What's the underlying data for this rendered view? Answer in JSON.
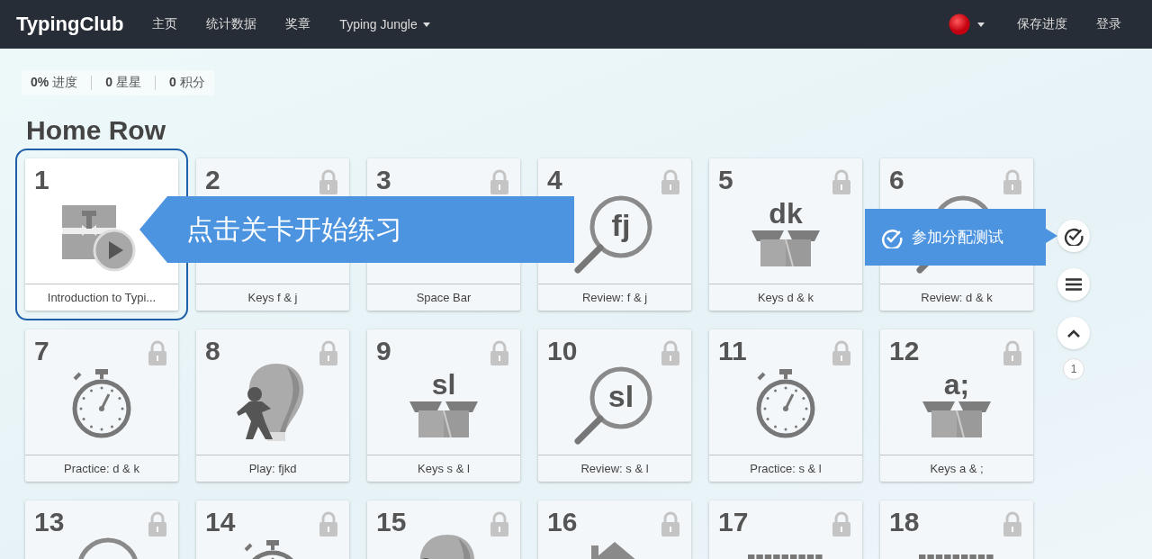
{
  "nav": {
    "logo": "TypingClub",
    "items": [
      {
        "label": "主页",
        "dropdown": false
      },
      {
        "label": "统计数据",
        "dropdown": false
      },
      {
        "label": "奖章",
        "dropdown": false
      },
      {
        "label": "Typing Jungle",
        "dropdown": true
      }
    ],
    "right_items": [
      "保存进度",
      "登录"
    ]
  },
  "stats": [
    {
      "value": "0%",
      "label": "进度"
    },
    {
      "value": "0",
      "label": "星星"
    },
    {
      "value": "0",
      "label": "积分"
    }
  ],
  "section_title": "Home Row",
  "lessons": [
    {
      "number": "1",
      "title": "Introduction to Typi...",
      "kind": "intro",
      "locked": false,
      "selected": true
    },
    {
      "number": "2",
      "title": "Keys f & j",
      "locked": true,
      "selected": false
    },
    {
      "number": "3",
      "title": "Space Bar",
      "locked": true,
      "selected": false
    },
    {
      "number": "4",
      "title": "Review: f & j",
      "kind": "review",
      "letters": "fj",
      "locked": true,
      "selected": false
    },
    {
      "number": "5",
      "title": "Keys d & k",
      "kind": "keys",
      "letters": "dk",
      "locked": true,
      "selected": false
    },
    {
      "number": "6",
      "title": "Review: d & k",
      "kind": "review",
      "locked": true,
      "selected": false
    },
    {
      "number": "7",
      "title": "Practice: d & k",
      "kind": "practice",
      "locked": true,
      "selected": false
    },
    {
      "number": "8",
      "title": "Play: fjkd",
      "kind": "game",
      "locked": true,
      "selected": false
    },
    {
      "number": "9",
      "title": "Keys s & l",
      "kind": "keys",
      "letters": "sl",
      "locked": true,
      "selected": false
    },
    {
      "number": "10",
      "title": "Review: s & l",
      "kind": "review",
      "letters": "sl",
      "locked": true,
      "selected": false
    },
    {
      "number": "11",
      "title": "Practice: s & l",
      "kind": "practice",
      "locked": true,
      "selected": false
    },
    {
      "number": "12",
      "title": "Keys a & ;",
      "kind": "keys",
      "letters": "a;",
      "locked": true,
      "selected": false
    },
    {
      "number": "13",
      "kind": "review",
      "locked": true,
      "selected": false
    },
    {
      "number": "14",
      "kind": "practice",
      "locked": true,
      "selected": false
    },
    {
      "number": "15",
      "kind": "game",
      "locked": true,
      "selected": false
    },
    {
      "number": "16",
      "kind": "home",
      "locked": true,
      "selected": false
    },
    {
      "number": "17",
      "kind": "keyboard",
      "locked": true,
      "selected": false
    },
    {
      "number": "18",
      "kind": "keyboard",
      "locked": true,
      "selected": false
    }
  ],
  "start_hint": "点击关卡开始练习",
  "assessment_tooltip": "参加分配测试",
  "page_indicator": "1"
}
